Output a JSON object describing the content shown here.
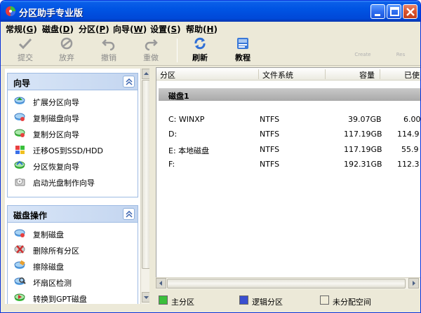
{
  "window": {
    "title": "分区助手专业版"
  },
  "menu": [
    {
      "label": "常规",
      "key": "G"
    },
    {
      "label": "磁盘",
      "key": "D"
    },
    {
      "label": "分区",
      "key": "P"
    },
    {
      "label": "向导",
      "key": "W"
    },
    {
      "label": "设置",
      "key": "S"
    },
    {
      "label": "帮助",
      "key": "H"
    }
  ],
  "toolbar": {
    "submit": "提交",
    "discard": "放弃",
    "undo": "撤销",
    "redo": "重做",
    "refresh": "刷新",
    "tutorial": "教程",
    "extra1": "Create",
    "extra2": "Res"
  },
  "wizard": {
    "title": "向导",
    "items": [
      "扩展分区向导",
      "复制磁盘向导",
      "复制分区向导",
      "迁移OS到SSD/HDD",
      "分区恢复向导",
      "启动光盘制作向导"
    ]
  },
  "diskops": {
    "title": "磁盘操作",
    "items": [
      "复制磁盘",
      "删除所有分区",
      "擦除磁盘",
      "坏扇区检测",
      "转换到GPT磁盘"
    ]
  },
  "table": {
    "headers": [
      "分区",
      "文件系统",
      "容量",
      "已使"
    ],
    "disk_label": "磁盘1",
    "rows": [
      {
        "partition": "C: WINXP",
        "fs": "NTFS",
        "capacity": "39.07GB",
        "used": "6.00"
      },
      {
        "partition": "D:",
        "fs": "NTFS",
        "capacity": "117.19GB",
        "used": "114.9"
      },
      {
        "partition": "E: 本地磁盘",
        "fs": "NTFS",
        "capacity": "117.19GB",
        "used": "55.9"
      },
      {
        "partition": "F:",
        "fs": "NTFS",
        "capacity": "192.31GB",
        "used": "112.3"
      }
    ]
  },
  "legend": {
    "primary": "主分区",
    "logical": "逻辑分区",
    "unallocated": "未分配空间",
    "primary_color": "#3bbf3b",
    "logical_color": "#3a4fd0",
    "unallocated_color": "#f0ecd8"
  }
}
